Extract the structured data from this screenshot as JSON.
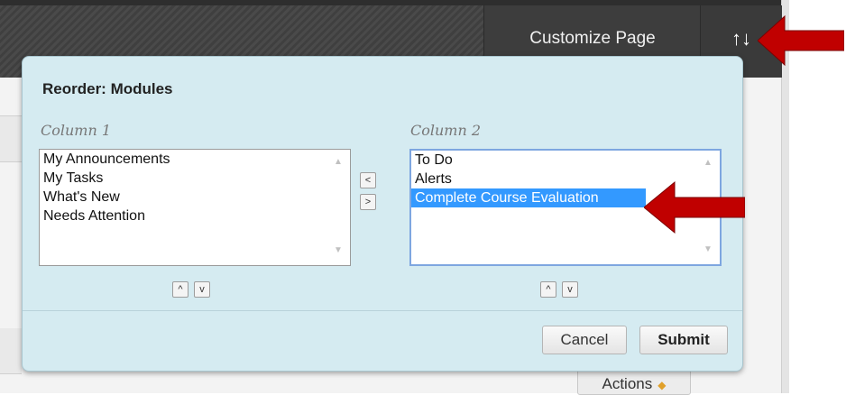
{
  "header": {
    "customize_label": "Customize Page",
    "reorder_glyph": "↑↓"
  },
  "background": {
    "actions_label": "Actions"
  },
  "dialog": {
    "title": "Reorder: Modules",
    "column1": {
      "label": "Column 1",
      "items": [
        "My Announcements",
        "My Tasks",
        "What's New",
        "Needs Attention"
      ]
    },
    "column2": {
      "label": "Column 2",
      "items": [
        "To Do",
        "Alerts",
        "Complete Course Evaluation"
      ],
      "selected": "Complete Course Evaluation"
    },
    "move_left_glyph": "<",
    "move_right_glyph": ">",
    "move_up_glyph": "^",
    "move_down_glyph": "v",
    "cancel_label": "Cancel",
    "submit_label": "Submit"
  },
  "colors": {
    "dialog_bg": "#d5ebf1",
    "selection": "#3399ff",
    "annotation_arrow": "#c00000"
  }
}
